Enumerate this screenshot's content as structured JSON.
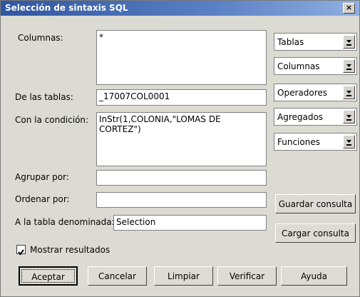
{
  "window": {
    "title": "Selección de sintaxis SQL",
    "close_label": "×"
  },
  "labels": {
    "columnas": "Columnas:",
    "tablas": "De las tablas:",
    "condicion": "Con la condición:",
    "agrupar": "Agrupar por:",
    "ordenar": "Ordenar por:",
    "tabla_denominada": "A la tabla denominada:"
  },
  "fields": {
    "columnas": "*",
    "tablas": "_17007COL0001",
    "condicion": "InStr(1,COLONIA,\"LOMAS DE CORTEZ\")",
    "agrupar": "",
    "ordenar": "",
    "tabla_denominada": "Selection"
  },
  "dropdowns": [
    "Tablas",
    "Columnas",
    "Operadores",
    "Agregados",
    "Funciones"
  ],
  "side_buttons": {
    "guardar": "Guardar consulta",
    "cargar": "Cargar consulta"
  },
  "checkbox": {
    "label": "Mostrar resultados",
    "checked": true
  },
  "buttons": {
    "aceptar": "Aceptar",
    "cancelar": "Cancelar",
    "limpiar": "Limpiar",
    "verificar": "Verificar",
    "ayuda": "Ayuda"
  }
}
